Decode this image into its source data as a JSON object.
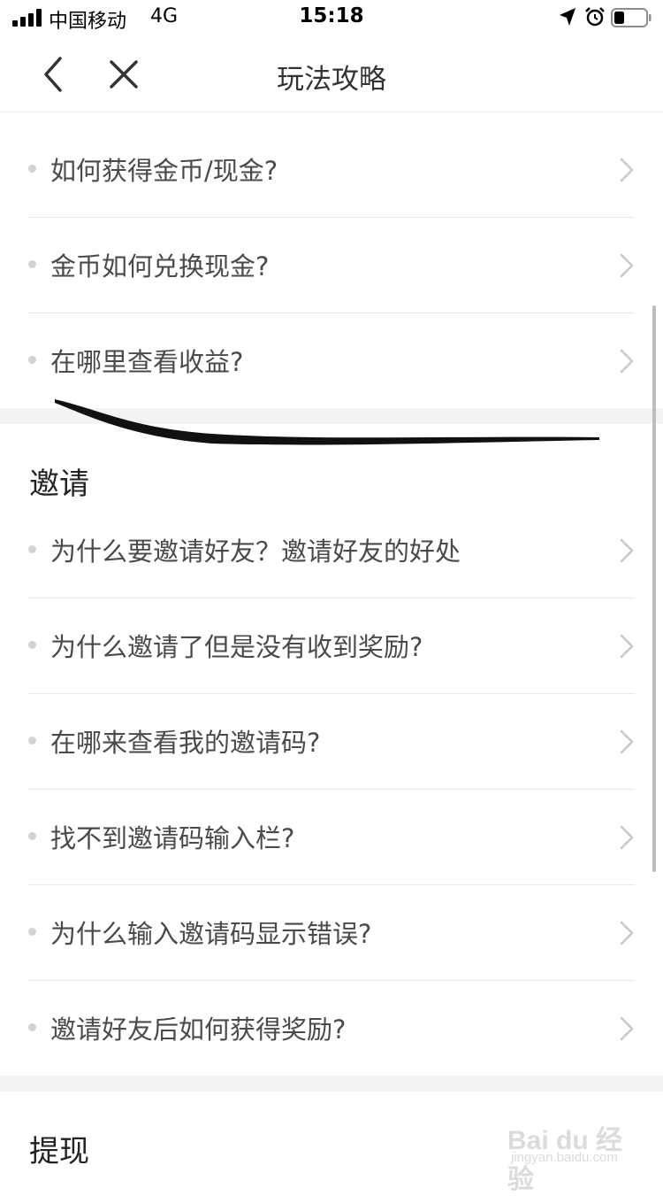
{
  "status_bar": {
    "carrier": "中国移动",
    "network": "4G",
    "time": "15:18",
    "icons": [
      "signal-icon",
      "location-icon",
      "alarm-icon",
      "battery-icon"
    ]
  },
  "nav": {
    "title": "玩法攻略",
    "back_icon": "chevron-left-icon",
    "close_icon": "close-icon"
  },
  "coins_section": {
    "items": [
      {
        "label": "如何获得金币/现金?"
      },
      {
        "label": "金币如何兑换现金?"
      },
      {
        "label": "在哪里查看收益?"
      }
    ]
  },
  "invite_section": {
    "title": "邀请",
    "items": [
      {
        "label": "为什么要邀请好友？邀请好友的好处"
      },
      {
        "label": "为什么邀请了但是没有收到奖励?"
      },
      {
        "label": "在哪来查看我的邀请码?"
      },
      {
        "label": "找不到邀请码输入栏?"
      },
      {
        "label": "为什么输入邀请码显示错误?"
      },
      {
        "label": "邀请好友后如何获得奖励?"
      }
    ]
  },
  "withdraw_section": {
    "title": "提现"
  },
  "watermark": {
    "text": "Bai du 经验",
    "sub": "jingyan.baidu.com"
  },
  "colors": {
    "background": "#ffffff",
    "separator": "#f3f3f3",
    "text": "#4a4a4a",
    "dot": "#d2d2d2",
    "chevron": "#c8c8c8"
  }
}
